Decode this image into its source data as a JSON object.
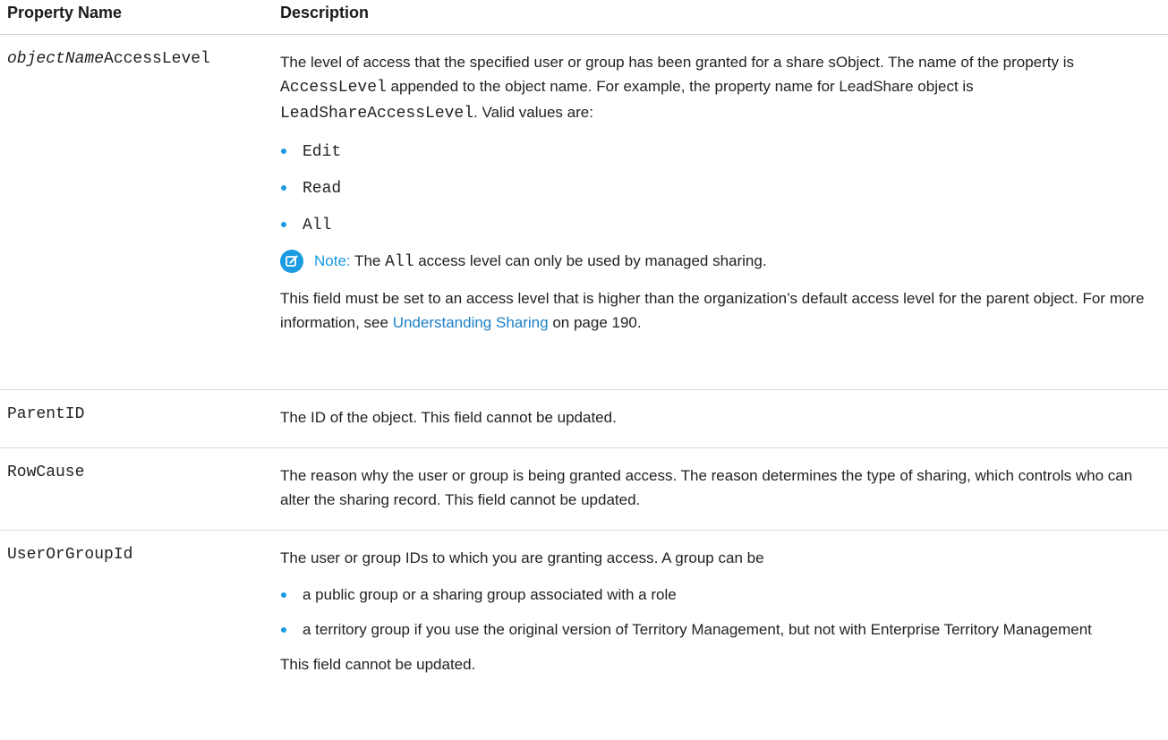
{
  "header": {
    "col1": "Property Name",
    "col2": "Description"
  },
  "rows": [
    {
      "prop_italic": "objectName",
      "prop_plain": "AccessLevel",
      "p1_a": "The level of access that the specified user or group has been granted for a share sObject. The name of the property is ",
      "p1_code": "AccessLevel",
      "p1_b": " appended to the object name. For example, the property name for LeadShare object is ",
      "p1_code2": "LeadShareAccessLevel",
      "p1_c": ". Valid values are:",
      "values": [
        "Edit",
        "Read",
        "All"
      ],
      "note_label": "Note:",
      "note_a": " The ",
      "note_code": "All",
      "note_b": " access level can only be used by managed sharing.",
      "p2_a": "This field must be set to an access level that is higher than the organization’s default access level for the parent object. For more information, see ",
      "p2_link": "Understanding Sharing",
      "p2_b": " on page 190."
    },
    {
      "prop": "ParentID",
      "desc": "The ID of the object. This field cannot be updated."
    },
    {
      "prop": "RowCause",
      "desc": "The reason why the user or group is being granted access. The reason determines the type of sharing, which controls who can alter the sharing record. This field cannot be updated."
    },
    {
      "prop": "UserOrGroupId",
      "intro": "The user or group IDs to which you are granting access. A group can be",
      "items": [
        "a public group or a sharing group associated with a role",
        "a territory group if you use the original version of Territory Management, but not with Enterprise Territory Management"
      ],
      "outro": "This field cannot be updated."
    }
  ],
  "colors": {
    "accent": "#1b9be0",
    "link": "#1b7fc6"
  },
  "icons": {
    "note": "note-edit-icon"
  }
}
